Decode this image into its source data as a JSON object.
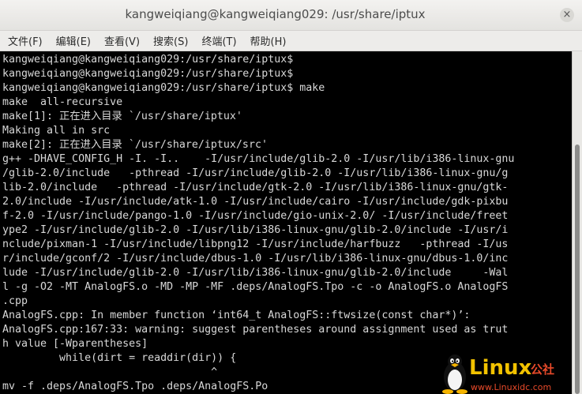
{
  "window": {
    "title": "kangweiqiang@kangweiqiang029: /usr/share/iptux",
    "close_symbol": "×"
  },
  "menu": [
    {
      "label": "文件(F)"
    },
    {
      "label": "编辑(E)"
    },
    {
      "label": "查看(V)"
    },
    {
      "label": "搜索(S)"
    },
    {
      "label": "终端(T)"
    },
    {
      "label": "帮助(H)"
    }
  ],
  "terminal": {
    "lines": [
      "kangweiqiang@kangweiqiang029:/usr/share/iptux$",
      "kangweiqiang@kangweiqiang029:/usr/share/iptux$",
      "kangweiqiang@kangweiqiang029:/usr/share/iptux$ make",
      "make  all-recursive",
      "make[1]: 正在进入目录 `/usr/share/iptux'",
      "Making all in src",
      "make[2]: 正在进入目录 `/usr/share/iptux/src'",
      "g++ -DHAVE_CONFIG_H -I. -I..    -I/usr/include/glib-2.0 -I/usr/lib/i386-linux-gnu",
      "/glib-2.0/include   -pthread -I/usr/include/glib-2.0 -I/usr/lib/i386-linux-gnu/g",
      "lib-2.0/include   -pthread -I/usr/include/gtk-2.0 -I/usr/lib/i386-linux-gnu/gtk-",
      "2.0/include -I/usr/include/atk-1.0 -I/usr/include/cairo -I/usr/include/gdk-pixbu",
      "f-2.0 -I/usr/include/pango-1.0 -I/usr/include/gio-unix-2.0/ -I/usr/include/freet",
      "ype2 -I/usr/include/glib-2.0 -I/usr/lib/i386-linux-gnu/glib-2.0/include -I/usr/i",
      "nclude/pixman-1 -I/usr/include/libpng12 -I/usr/include/harfbuzz   -pthread -I/us",
      "r/include/gconf/2 -I/usr/include/dbus-1.0 -I/usr/lib/i386-linux-gnu/dbus-1.0/inc",
      "lude -I/usr/include/glib-2.0 -I/usr/lib/i386-linux-gnu/glib-2.0/include     -Wal",
      "l -g -O2 -MT AnalogFS.o -MD -MP -MF .deps/AnalogFS.Tpo -c -o AnalogFS.o AnalogFS",
      ".cpp",
      "AnalogFS.cpp: In member function ‘int64_t AnalogFS::ftwsize(const char*)’:",
      "AnalogFS.cpp:167:33: warning: suggest parentheses around assignment used as trut",
      "h value [-Wparentheses]",
      "         while(dirt = readdir(dir)) {",
      "                                 ^",
      "mv -f .deps/AnalogFS.Tpo .deps/AnalogFS.Po"
    ]
  },
  "watermark": {
    "brand": "Linux",
    "brand_suffix": "公社",
    "url": "www.Linuxidc.com",
    "brand_color": "#f2c200",
    "accent_color": "#e84a2a"
  }
}
